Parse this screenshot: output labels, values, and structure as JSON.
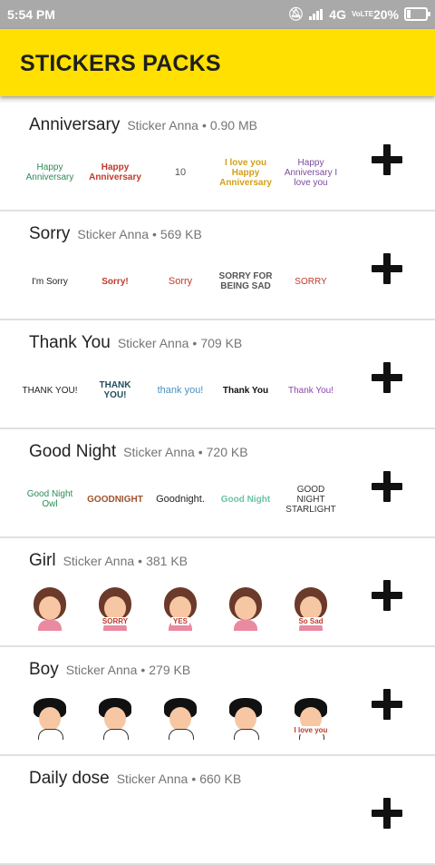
{
  "status": {
    "time": "5:54 PM",
    "network": "4G",
    "volte": "VoLTE",
    "battery": "20%",
    "battery_level": 0.2
  },
  "appbar": {
    "title": "STICKERS PACKS"
  },
  "packs": [
    {
      "name": "Anniversary",
      "author": "Sticker Anna",
      "size": "0.90 MB",
      "stickers": [
        "Happy Anniversary",
        "Happy Anniversary",
        "10",
        "I love you Happy Anniversary",
        "Happy Anniversary I love you"
      ]
    },
    {
      "name": "Sorry",
      "author": "Sticker Anna",
      "size": "569 KB",
      "stickers": [
        "I'm Sorry",
        "Sorry!",
        "Sorry",
        "SORRY FOR BEING SAD",
        "SORRY"
      ]
    },
    {
      "name": "Thank You",
      "author": "Sticker Anna",
      "size": "709 KB",
      "stickers": [
        "THANK YOU!",
        "THANK YOU!",
        "thank you!",
        "Thank You",
        "Thank You!"
      ]
    },
    {
      "name": "Good Night",
      "author": "Sticker Anna",
      "size": "720 KB",
      "stickers": [
        "Good Night Owl",
        "GOODNIGHT",
        "Goodnight.",
        "Good Night",
        "GOOD NIGHT STARLIGHT"
      ]
    },
    {
      "name": "Girl",
      "author": "Sticker Anna",
      "size": "381 KB",
      "stickers": [
        "",
        "SORRY",
        "YES",
        "",
        "So Sad"
      ]
    },
    {
      "name": "Boy",
      "author": "Sticker Anna",
      "size": "279 KB",
      "stickers": [
        "",
        "",
        "",
        "",
        "I love you"
      ]
    },
    {
      "name": "Daily dose",
      "author": "Sticker Anna",
      "size": "660 KB",
      "stickers": []
    }
  ]
}
